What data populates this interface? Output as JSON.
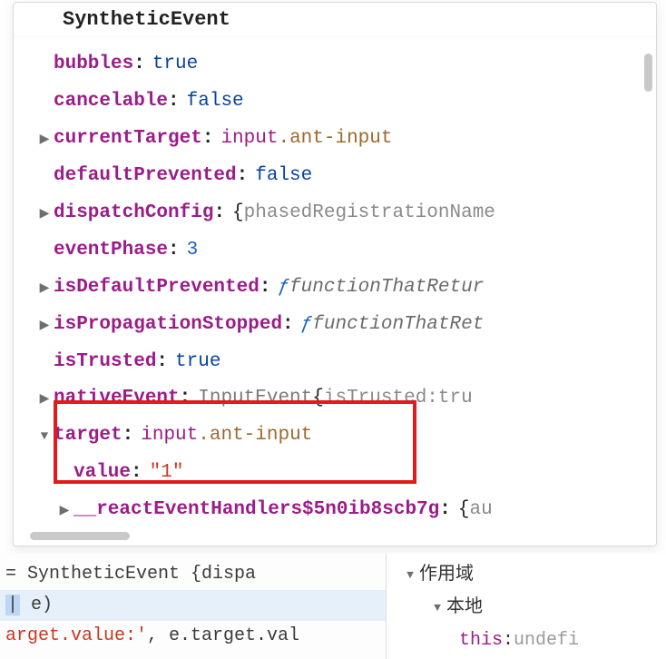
{
  "header": {
    "title": "SyntheticEvent"
  },
  "props": {
    "bubbles": {
      "key": "bubbles",
      "value": "true"
    },
    "cancelable": {
      "key": "cancelable",
      "value": "false"
    },
    "currentTarget": {
      "key": "currentTarget",
      "tag": "input",
      "dot": ".",
      "cls": "ant-input"
    },
    "defaultPrevented": {
      "key": "defaultPrevented",
      "value": "false"
    },
    "dispatchConfig": {
      "key": "dispatchConfig",
      "brace_open": "{",
      "preview": "phasedRegistrationName"
    },
    "eventPhase": {
      "key": "eventPhase",
      "value": "3"
    },
    "isDefaultPrevented": {
      "key": "isDefaultPrevented",
      "f": "ƒ",
      "fn": "functionThatRetur"
    },
    "isPropagationStopped": {
      "key": "isPropagationStopped",
      "f": "ƒ",
      "fn": "functionThatRet"
    },
    "isTrusted": {
      "key": "isTrusted",
      "value": "true"
    },
    "nativeEvent": {
      "key": "nativeEvent",
      "type": "InputEvent ",
      "brace_open": "{",
      "inner_key": "isTrusted: ",
      "inner_val": "tru"
    },
    "target": {
      "key": "target",
      "tag": "input",
      "dot": ".",
      "cls": "ant-input"
    },
    "value": {
      "key": "value",
      "value": "\"1\""
    },
    "reactHandlers": {
      "key": "__reactEventHandlers$5n0ib8scb7g",
      "brace_open": "{",
      "preview": "au"
    }
  },
  "source": {
    "line1_pre": " = ",
    "line1_sym": "SyntheticEvent ",
    "line1_rest": "{dispa",
    "line2_cursor": "e",
    "line2_rest": ")",
    "line2_mark": "|",
    "line3_pre": "arget.value:'",
    "line3_mid": ", e.target.val"
  },
  "scope": {
    "header": "作用域",
    "local": "本地",
    "this_key": "this",
    "this_val": "undefi"
  }
}
